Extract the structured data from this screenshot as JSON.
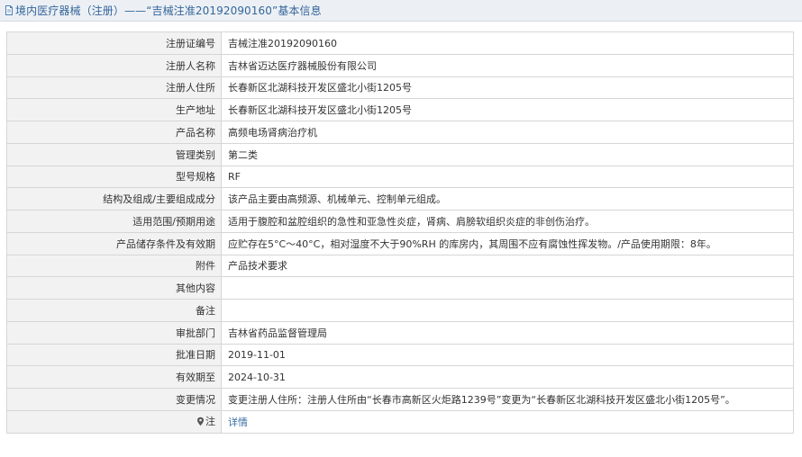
{
  "header": {
    "title": "境内医疗器械（注册）——“吉械注准20192090160”基本信息"
  },
  "rows": [
    {
      "label": "注册证编号",
      "value": "吉械注准20192090160"
    },
    {
      "label": "注册人名称",
      "value": "吉林省迈达医疗器械股份有限公司"
    },
    {
      "label": "注册人住所",
      "value": "长春新区北湖科技开发区盛北小街1205号"
    },
    {
      "label": "生产地址",
      "value": "长春新区北湖科技开发区盛北小街1205号"
    },
    {
      "label": "产品名称",
      "value": "高频电场肾病治疗机"
    },
    {
      "label": "管理类别",
      "value": "第二类"
    },
    {
      "label": "型号规格",
      "value": "RF"
    },
    {
      "label": "结构及组成/主要组成成分",
      "value": "该产品主要由高频源、机械单元、控制单元组成。"
    },
    {
      "label": "适用范围/预期用途",
      "value": "适用于腹腔和盆腔组织的急性和亚急性炎症，肾病、肩膀软组织炎症的非创伤治疗。"
    },
    {
      "label": "产品储存条件及有效期",
      "value": "应贮存在5°C～40°C，相对湿度不大于90%RH 的库房内，其周围不应有腐蚀性挥发物。/产品使用期限：8年。"
    },
    {
      "label": "附件",
      "value": "产品技术要求"
    },
    {
      "label": "其他内容",
      "value": ""
    },
    {
      "label": "备注",
      "value": ""
    },
    {
      "label": "审批部门",
      "value": "吉林省药品监督管理局"
    },
    {
      "label": "批准日期",
      "value": "2019-11-01"
    },
    {
      "label": "有效期至",
      "value": "2024-10-31"
    },
    {
      "label": "变更情况",
      "value": "变更注册人住所：注册人住所由“长春市高新区火炬路1239号”变更为“长春新区北湖科技开发区盛北小街1205号”。"
    }
  ],
  "note_row": {
    "label": "注",
    "link_text": "详情",
    "icon": "pin-icon"
  },
  "colors": {
    "header_bg": "#ecf0f4",
    "title_text": "#34659b",
    "label_bg": "#f2f2f2",
    "border": "#d6d6d6",
    "link": "#3a6ea5"
  }
}
